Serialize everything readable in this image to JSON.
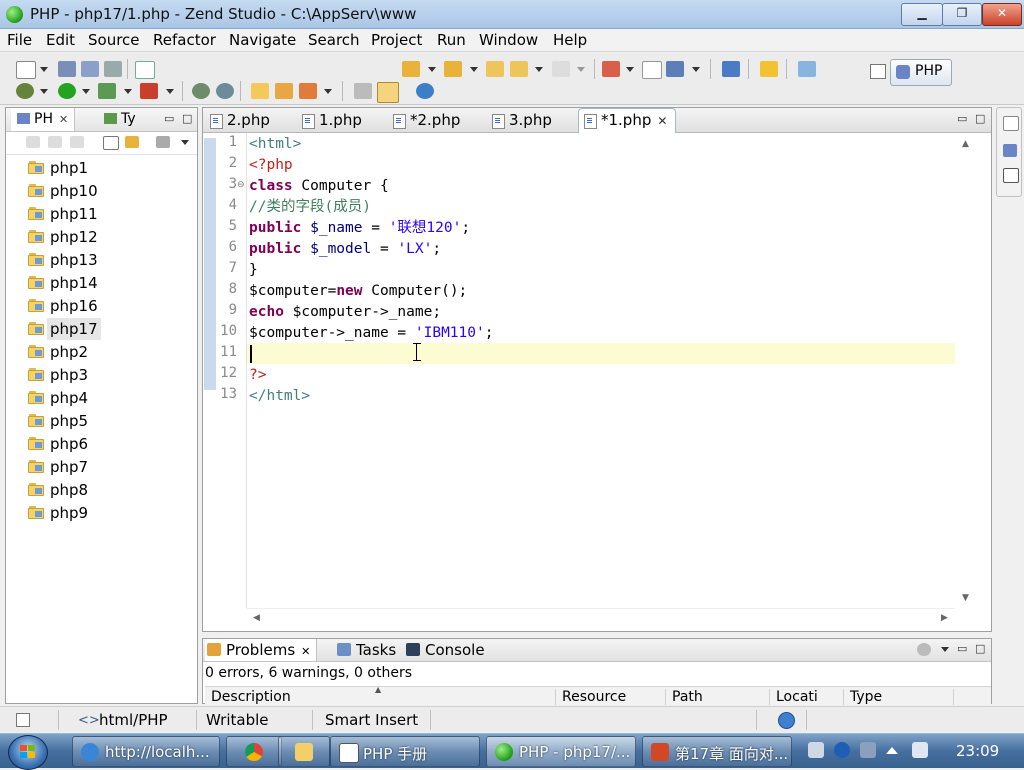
{
  "window": {
    "title": "PHP - php17/1.php - Zend Studio - C:\\AppServ\\www",
    "min_label": "▁",
    "max_label": "❐",
    "close_label": "✕"
  },
  "menu": {
    "items": [
      {
        "label": "File"
      },
      {
        "label": "Edit"
      },
      {
        "label": "Source"
      },
      {
        "label": "Refactor"
      },
      {
        "label": "Navigate"
      },
      {
        "label": "Search"
      },
      {
        "label": "Project"
      },
      {
        "label": "Run"
      },
      {
        "label": "Window"
      },
      {
        "label": "Help"
      }
    ]
  },
  "toolbar": {
    "perspective_label": "PHP"
  },
  "explorer": {
    "tabs": [
      {
        "label": "PH",
        "close": "✕"
      },
      {
        "label": "Ty"
      }
    ],
    "minimize": "▭",
    "maximize": "□",
    "items": [
      {
        "label": "php1"
      },
      {
        "label": "php10"
      },
      {
        "label": "php11"
      },
      {
        "label": "php12"
      },
      {
        "label": "php13"
      },
      {
        "label": "php14"
      },
      {
        "label": "php16"
      },
      {
        "label": "php17"
      },
      {
        "label": "php2"
      },
      {
        "label": "php3"
      },
      {
        "label": "php4"
      },
      {
        "label": "php5"
      },
      {
        "label": "php6"
      },
      {
        "label": "php7"
      },
      {
        "label": "php8"
      },
      {
        "label": "php9"
      }
    ],
    "selected": "php17"
  },
  "editor": {
    "tabs": [
      {
        "label": "2.php"
      },
      {
        "label": "1.php"
      },
      {
        "label": "*2.php"
      },
      {
        "label": "3.php"
      },
      {
        "label": "*1.php",
        "close": "✕",
        "active": true
      }
    ],
    "minimize": "▭",
    "maximize": "□",
    "line_numbers": [
      "1",
      "2",
      "3",
      "4",
      "5",
      "6",
      "7",
      "8",
      "9",
      "10",
      "11",
      "12",
      "13"
    ],
    "fold_marker": "⊖",
    "code": {
      "l1": "<html>",
      "l2": "<?php",
      "l3_kw": "class",
      "l3_rest": " Computer {",
      "l4": "//类的字段(成员)",
      "l5_kw": "public",
      "l5_var": " $_name",
      "l5_eq": " = ",
      "l5_str": "'联想120'",
      "l5_end": ";",
      "l6_kw": "public",
      "l6_var": " $_model",
      "l6_eq": " = ",
      "l6_str": "'LX'",
      "l6_end": ";",
      "l7": "}",
      "l8_a": "$computer=",
      "l8_kw": "new",
      "l8_b": " Computer();",
      "l9_kw": "echo",
      "l9_rest": " $computer->_name;",
      "l10_a": "$computer->_name = ",
      "l10_str": "'IBM110'",
      "l10_end": ";",
      "l11": "",
      "l12": "?>",
      "l13": "</html>"
    },
    "current_line": 11
  },
  "problems": {
    "tabs": [
      {
        "label": "Problems",
        "close": "✕"
      },
      {
        "label": "Tasks"
      },
      {
        "label": "Console"
      }
    ],
    "summary": "0 errors, 6 warnings, 0 others",
    "columns": [
      "Description",
      "Resource",
      "Path",
      "Locati",
      "Type"
    ],
    "minimize": "▭",
    "maximize": "□"
  },
  "statusbar": {
    "nav_icon": "<>",
    "file_type": "html/PHP",
    "write_mode": "Writable",
    "insert_mode": "Smart Insert"
  },
  "taskbar": {
    "items": [
      {
        "label": "http://localh..."
      },
      {
        "label": "PHP 手册"
      },
      {
        "label": "PHP - php17/..."
      },
      {
        "label": "第17章 面向对..."
      }
    ],
    "clock": "23:09"
  },
  "colors": {
    "keyword": "#7f0055",
    "tag": "#3f7f7f",
    "php_delim": "#c22015",
    "string": "#2a00ff",
    "comment": "#3f7f5f",
    "current_line_bg": "#fdfbd1"
  }
}
